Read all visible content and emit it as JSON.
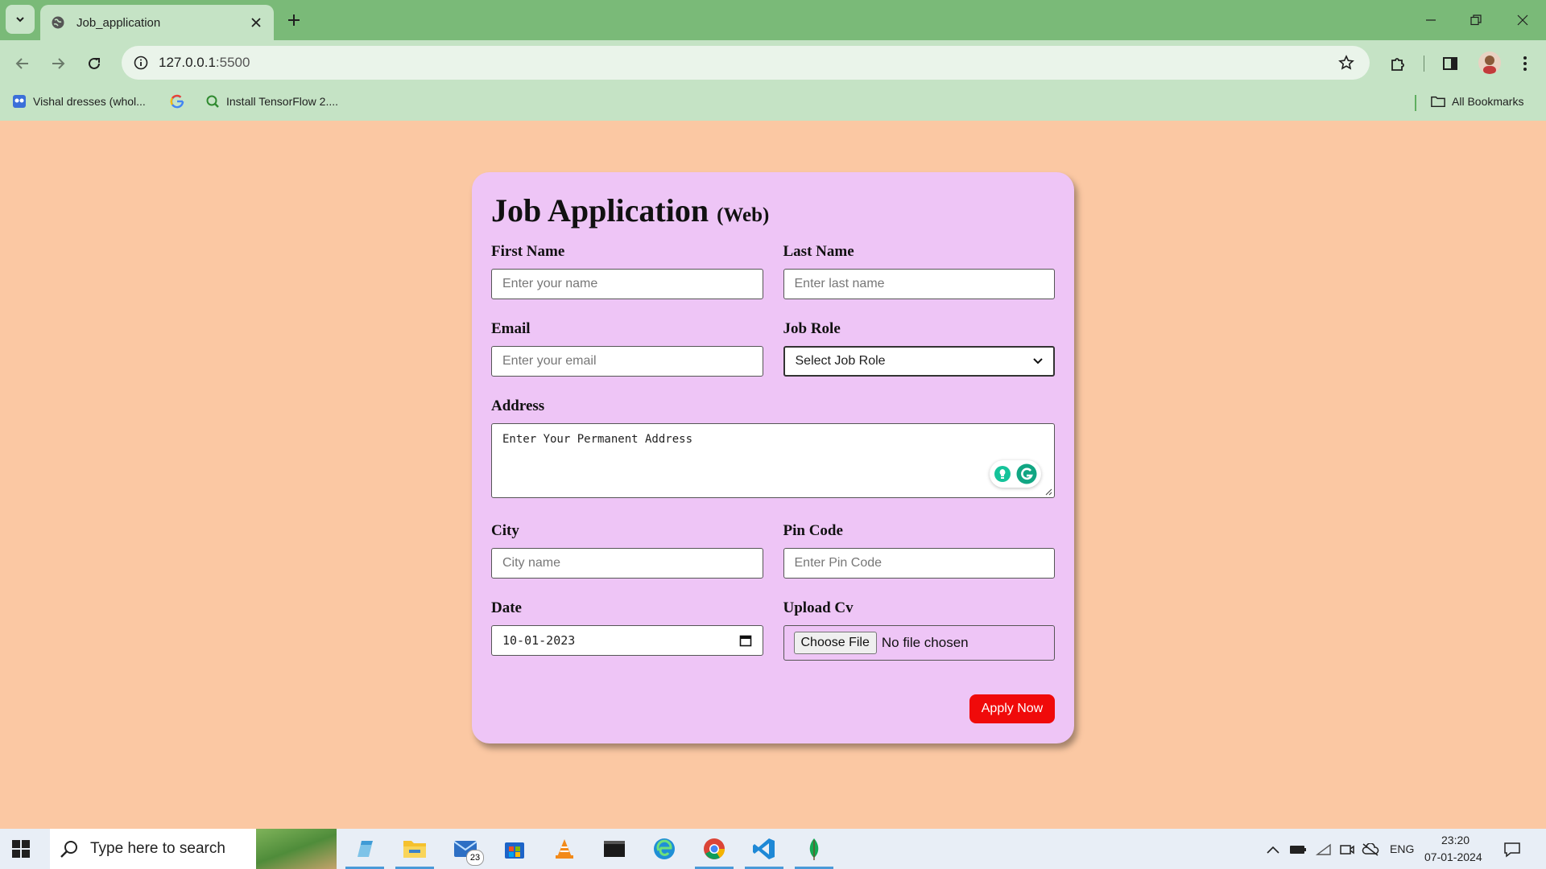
{
  "browser": {
    "tab_title": "Job_application",
    "url_host": "127.0.0.1",
    "url_port": ":5500",
    "bookmarks": [
      {
        "label": "Vishal dresses (whol..."
      },
      {
        "label": ""
      },
      {
        "label": "Install TensorFlow 2...."
      }
    ],
    "all_bookmarks_label": "All Bookmarks"
  },
  "form": {
    "title": "Job Application",
    "title_suffix": "(Web)",
    "first_name": {
      "label": "First Name",
      "placeholder": "Enter your name"
    },
    "last_name": {
      "label": "Last Name",
      "placeholder": "Enter last name"
    },
    "email": {
      "label": "Email",
      "placeholder": "Enter your email"
    },
    "job_role": {
      "label": "Job Role",
      "selected": "Select Job Role"
    },
    "address": {
      "label": "Address",
      "placeholder": "Enter Your Permanent Address"
    },
    "city": {
      "label": "City",
      "placeholder": "City name"
    },
    "pin_code": {
      "label": "Pin Code",
      "placeholder": "Enter Pin Code"
    },
    "date": {
      "label": "Date",
      "value": "10-01-2023"
    },
    "upload_cv": {
      "label": "Upload Cv",
      "button": "Choose File",
      "status": "No file chosen"
    },
    "submit_label": "Apply Now",
    "colors": {
      "card": "#eec5f6",
      "page": "#fbc8a3",
      "button": "#f00a0a"
    }
  },
  "taskbar": {
    "search_placeholder": "Type here to search",
    "mail_badge": "23",
    "language": "ENG",
    "time": "23:20",
    "date": "07-01-2024"
  }
}
